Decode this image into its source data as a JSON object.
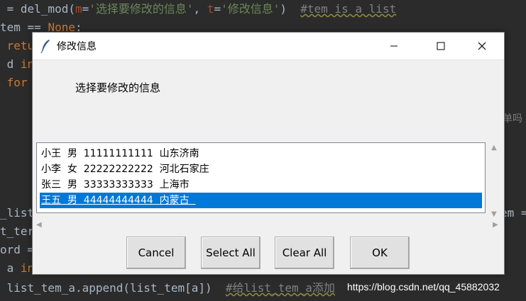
{
  "editor": {
    "line1": {
      "prefix": " = del_mod(",
      "p1": "m",
      "eq1": "=",
      "s1": "'选择要修改的信息'",
      "sep": ", ",
      "p2": "t",
      "eq2": "=",
      "s2": "'修改信息'",
      "close": ")  ",
      "comment": "#tem is a list"
    },
    "line2": {
      "text": "tem == ",
      "kw": "None",
      "rest": ":"
    },
    "line3": {
      "kw": " retu"
    },
    "line4": {
      "text": " d ",
      "kw": "in"
    },
    "line5": {
      "kw": " for"
    },
    "line6": {
      "text": "_list"
    },
    "line6_right": {
      "text": "em ="
    },
    "line7": {
      "text": "t_ter"
    },
    "line8": {
      "text": "ord ="
    },
    "line9": {
      "text": " a ",
      "kw": "in"
    },
    "line10": {
      "text": " list_tem_a.append(list_tem[a])  ",
      "comment": "#给list_tem_a添加"
    },
    "side_text": "单吗"
  },
  "watermark": "https://blog.csdn.net/qq_45882032",
  "dialog": {
    "title": "修改信息",
    "prompt": "选择要修改的信息",
    "items": [
      "小王  男  11111111111  山东济南",
      "小李  女  22222222222  河北石家庄",
      "张三  男  33333333333  上海市",
      "王五  男  44444444444  内蒙古  "
    ],
    "selected_index": 3,
    "buttons": {
      "cancel": "Cancel",
      "select_all": "Select All",
      "clear_all": "Clear All",
      "ok": "OK"
    }
  },
  "colors": {
    "editor_bg": "#2b2b2b",
    "selection": "#0078d7",
    "dialog_bg": "#f0f0f0"
  }
}
